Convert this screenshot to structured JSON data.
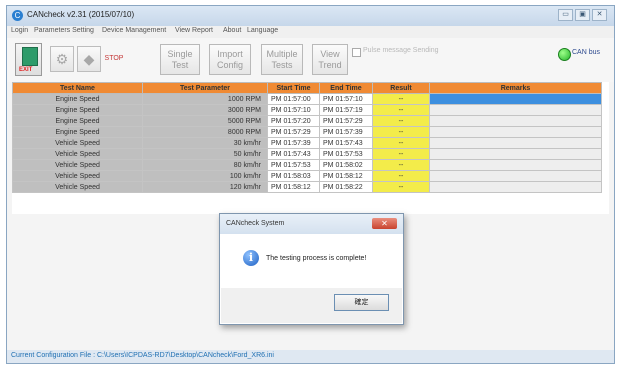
{
  "window": {
    "title": "CANcheck v2.31 (2015/07/10)",
    "controls": {
      "minimize": "▭",
      "maximize": "▣",
      "close": "✕"
    }
  },
  "menu": [
    "Login",
    "Parameters Setting",
    "Device Management",
    "View Report",
    "About",
    "Language"
  ],
  "toolbar": {
    "exit_label": "EXIT",
    "stop_label": "STOP",
    "single_test": [
      "Single",
      "Test"
    ],
    "import_config": [
      "Import",
      "Config"
    ],
    "multiple_tests": [
      "Multiple",
      "Tests"
    ],
    "view_trend": [
      "View",
      "Trend"
    ],
    "checkbox_label": "Pulse message Sending",
    "can_bus_label": "CAN bus",
    "can_bus_color": "#25b52b"
  },
  "table": {
    "headers": [
      "Test Name",
      "Test Parameter",
      "Start Time",
      "End Time",
      "Result",
      "Remarks"
    ],
    "rows": [
      [
        "Engine Speed",
        "1000 RPM",
        "PM  01:57:00",
        "PM  01:57:10",
        "--",
        ""
      ],
      [
        "Engine Speed",
        "3000 RPM",
        "PM  01:57:10",
        "PM  01:57:19",
        "--",
        ""
      ],
      [
        "Engine Speed",
        "5000 RPM",
        "PM  01:57:20",
        "PM  01:57:29",
        "--",
        ""
      ],
      [
        "Engine Speed",
        "8000 RPM",
        "PM  01:57:29",
        "PM  01:57:39",
        "--",
        ""
      ],
      [
        "Vehicle Speed",
        "30 km/hr",
        "PM  01:57:39",
        "PM  01:57:43",
        "--",
        ""
      ],
      [
        "Vehicle Speed",
        "50 km/hr",
        "PM  01:57:43",
        "PM  01:57:53",
        "--",
        ""
      ],
      [
        "Vehicle Speed",
        "80 km/hr",
        "PM  01:57:53",
        "PM  01:58:02",
        "--",
        ""
      ],
      [
        "Vehicle Speed",
        "100 km/hr",
        "PM  01:58:03",
        "PM  01:58:12",
        "--",
        ""
      ],
      [
        "Vehicle Speed",
        "120 km/hr",
        "PM  01:58:12",
        "PM  01:58:22",
        "--",
        ""
      ]
    ],
    "selected_row": 0
  },
  "dialog": {
    "title": "CANcheck System",
    "message": "The testing process is complete!",
    "ok_label": "確定",
    "close_glyph": "✕",
    "info_glyph": "i"
  },
  "status": {
    "text": "Current Configuration File : C:\\Users\\ICPDAS-RD7\\Desktop\\CANcheck\\Ford_XR6.ini"
  }
}
